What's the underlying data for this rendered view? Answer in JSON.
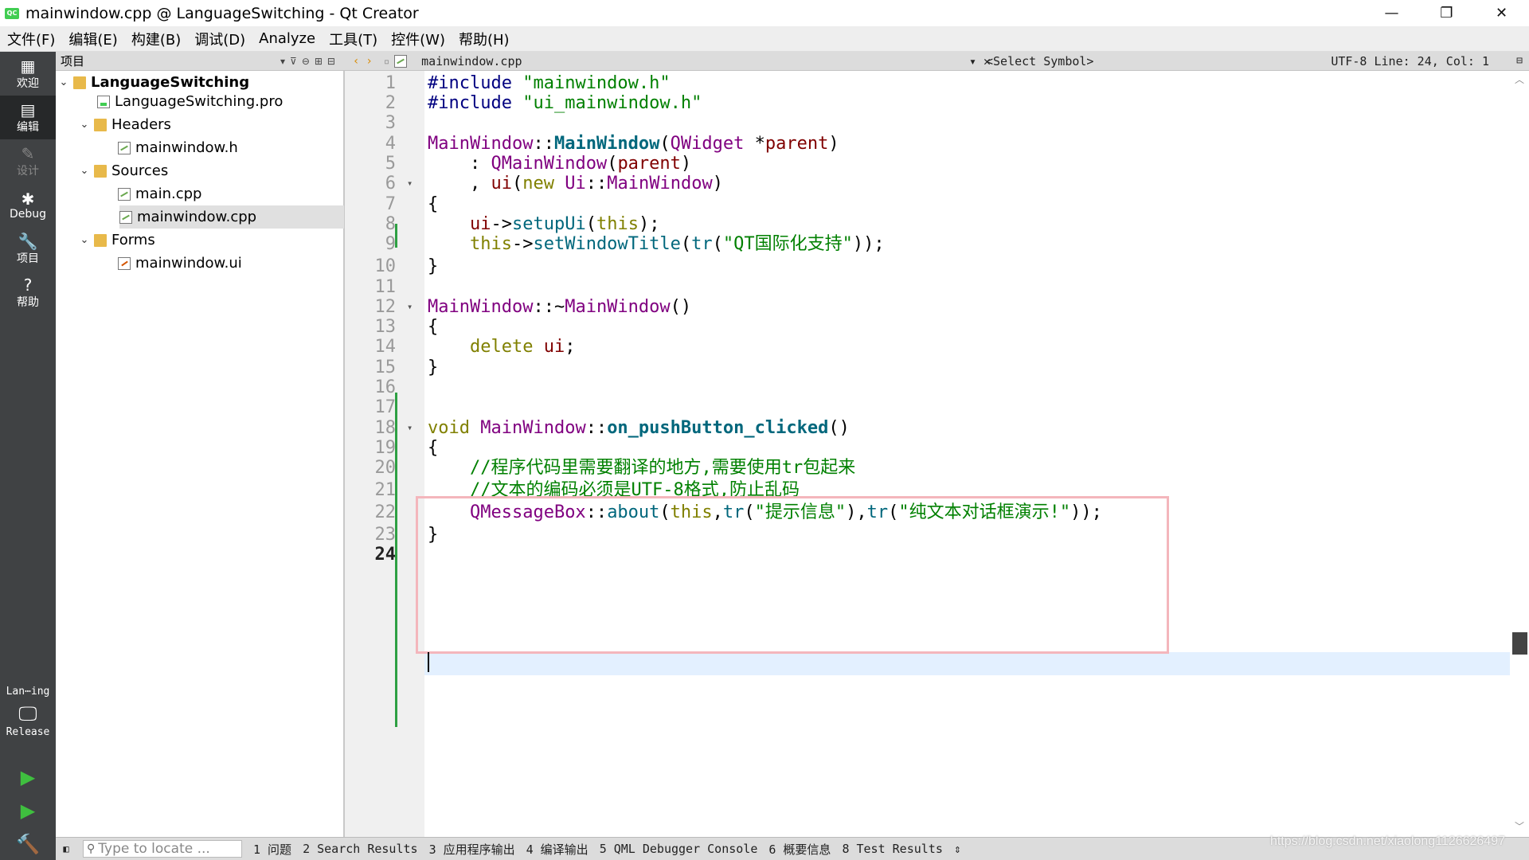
{
  "window": {
    "title": "mainwindow.cpp @ LanguageSwitching - Qt Creator",
    "app_icon_label": "QC",
    "minimize": "—",
    "restore": "❐",
    "close": "✕"
  },
  "menu": [
    "文件(F)",
    "编辑(E)",
    "构建(B)",
    "调试(D)",
    "Analyze",
    "工具(T)",
    "控件(W)",
    "帮助(H)"
  ],
  "modes": [
    {
      "label": "欢迎",
      "icon": "▦"
    },
    {
      "label": "编辑",
      "icon": "▤"
    },
    {
      "label": "设计",
      "icon": "✎"
    },
    {
      "label": "Debug",
      "icon": "✱"
    },
    {
      "label": "项目",
      "icon": "🔧"
    },
    {
      "label": "帮助",
      "icon": "?"
    }
  ],
  "kit": {
    "name": "Lan⋯ing",
    "config": "Release"
  },
  "project_panel": {
    "title": "项目",
    "tree": [
      {
        "label": "LanguageSwitching",
        "level": 0,
        "type": "project"
      },
      {
        "label": "LanguageSwitching.pro",
        "level": 1,
        "type": "pro"
      },
      {
        "label": "Headers",
        "level": 1,
        "type": "folder"
      },
      {
        "label": "mainwindow.h",
        "level": 2,
        "type": "h"
      },
      {
        "label": "Sources",
        "level": 1,
        "type": "folder"
      },
      {
        "label": "main.cpp",
        "level": 2,
        "type": "cpp"
      },
      {
        "label": "mainwindow.cpp",
        "level": 2,
        "type": "cpp"
      },
      {
        "label": "Forms",
        "level": 1,
        "type": "folder"
      },
      {
        "label": "mainwindow.ui",
        "level": 2,
        "type": "ui"
      }
    ]
  },
  "editor_toolbar": {
    "file": "mainwindow.cpp",
    "symbol": "<Select Symbol>",
    "status": "UTF-8 Line: 24, Col: 1"
  },
  "code": {
    "current_line": 24,
    "lines": [
      "#include \"mainwindow.h\"",
      "#include \"ui_mainwindow.h\"",
      "",
      "MainWindow::MainWindow(QWidget *parent)",
      "    : QMainWindow(parent)",
      "    , ui(new Ui::MainWindow)",
      "{",
      "    ui->setupUi(this);",
      "    this->setWindowTitle(tr(\"QT国际化支持\"));",
      "}",
      "",
      "MainWindow::~MainWindow()",
      "{",
      "    delete ui;",
      "}",
      "",
      "",
      "void MainWindow::on_pushButton_clicked()",
      "{",
      "    //程序代码里需要翻译的地方,需要使用tr包起来",
      "    //文本的编码必须是UTF-8格式,防止乱码",
      "    QMessageBox::about(this,tr(\"提示信息\"),tr(\"纯文本对话框演示!\"));",
      "}",
      ""
    ]
  },
  "bottom_bar": {
    "locate_placeholder": "Type to locate ...",
    "tabs": [
      "1 问题",
      "2 Search Results",
      "3 应用程序输出",
      "4 编译输出",
      "5 QML Debugger Console",
      "6 概要信息",
      "8 Test Results"
    ]
  },
  "watermark": "https://blog.csdn.net/xiaolong1126626497"
}
